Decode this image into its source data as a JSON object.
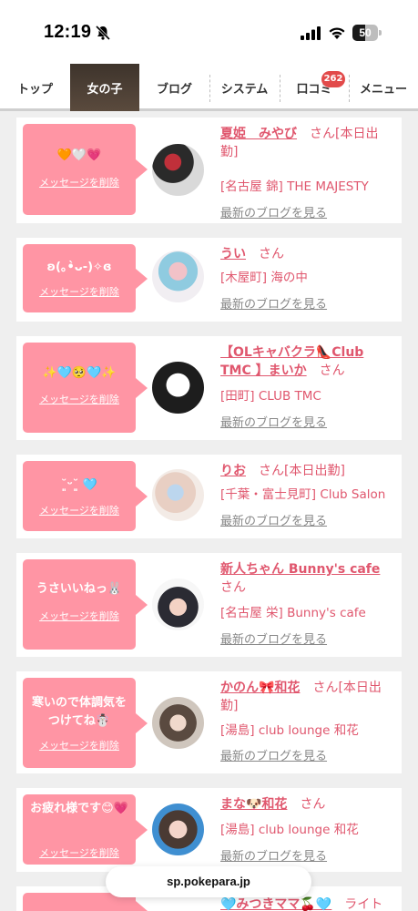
{
  "status": {
    "time": "12:19",
    "battery": "50",
    "battery_level": 0.5
  },
  "tabs": [
    {
      "label": "トップ"
    },
    {
      "label": "女の子",
      "active": true
    },
    {
      "label": "ブログ"
    },
    {
      "label": "システム"
    },
    {
      "label": "口コミ",
      "badge": "262"
    },
    {
      "label": "メニュー"
    }
  ],
  "delete_label": "メッセージを削除",
  "blog_label": "最新のブログを見る",
  "girls": [
    {
      "message": "🧡🤍💗",
      "name": "夏姫　みやび",
      "san": "さん",
      "status": "[本日出勤]",
      "shop": "[名古屋 錦] THE MAJESTY"
    },
    {
      "message": "ʚ(｡•̀ᴗ-)✧ɞ",
      "name": "うい",
      "san": "さん",
      "status": "",
      "shop": "[木屋町] 海の中"
    },
    {
      "message": "✨🩵🥺🩵✨",
      "name": "【OLキャバクラ👠Club TMC 】まいか",
      "san": "さん",
      "status": "",
      "shop": "[田町] CLUB TMC"
    },
    {
      "message": "˘͈ᵕ˘͈ 🩵",
      "name": "りお",
      "san": "さん",
      "status": "[本日出勤]",
      "shop": "[千葉・富士見町] Club Salon"
    },
    {
      "message": "うさいいねっ🐰",
      "name": "新人ちゃん Bunny's cafe",
      "san": "さん",
      "status": "",
      "shop": "[名古屋 栄] Bunny's cafe"
    },
    {
      "message": "寒いので体調気をつけてね☃️",
      "name": "かのん🎀和花",
      "san": "さん",
      "status": "[本日出勤]",
      "shop": "[湯島] club lounge 和花"
    },
    {
      "message": "お疲れ様です😊💗",
      "name": "まな🐶和花",
      "san": "さん",
      "status": "",
      "shop": "[湯島] club lounge 和花"
    },
    {
      "message": "",
      "name": "🩵みつきママ🍒🩵",
      "san": "ライト",
      "status": "",
      "shop": ""
    }
  ],
  "url": "sp.pokepara.jp"
}
